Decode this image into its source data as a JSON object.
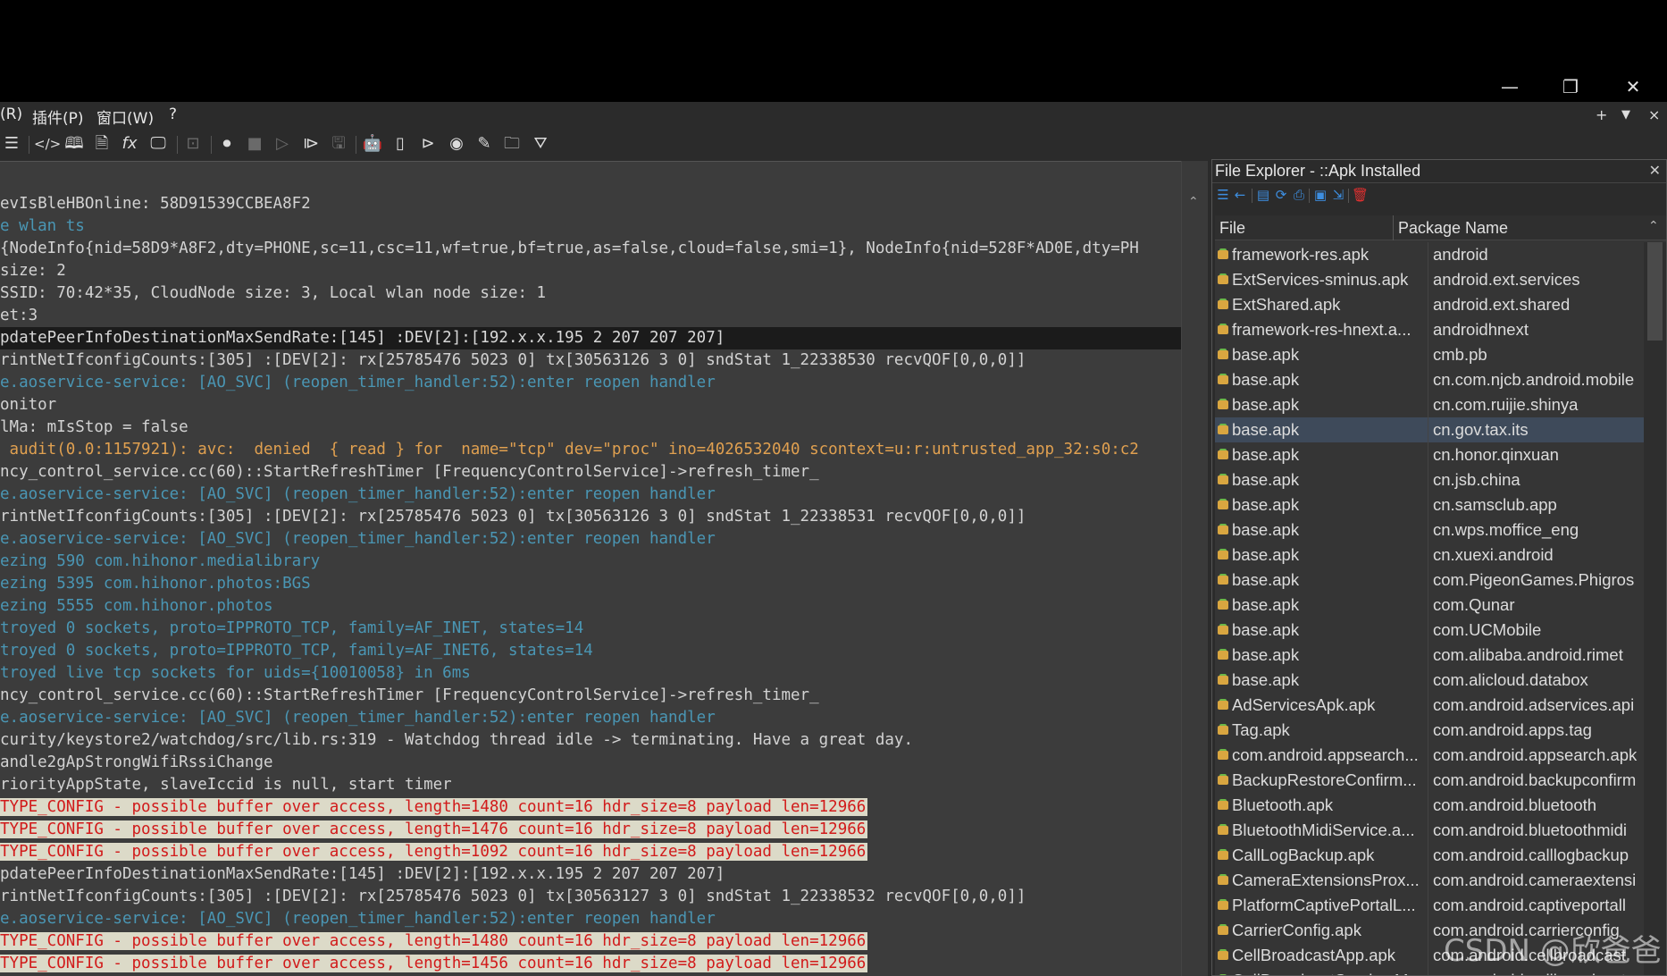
{
  "window": {
    "minimize_glyph": "—",
    "restore_glyph": "❐",
    "close_glyph": "✕"
  },
  "menu": {
    "items": [
      "(R)",
      "插件(P)",
      "窗口(W)",
      "?"
    ],
    "right_add": "+",
    "right_dropdown": "▼",
    "right_close": "×"
  },
  "toolbar": {
    "icons": [
      "list-icon",
      "code-icon",
      "book-icon",
      "document-icon",
      "function-icon",
      "screen-icon",
      "camera-focus-icon",
      "record-icon",
      "stop-icon",
      "play-icon",
      "play-box-icon",
      "save-icon",
      "android-icon",
      "phone-icon",
      "terminal-icon",
      "camera-icon",
      "edit-icon",
      "folder-icon",
      "filter-icon"
    ]
  },
  "log": {
    "lines": [
      {
        "text": "evIsBleHBOnline: 58D91539CCBEA8F2",
        "level": "default"
      },
      {
        "text": "e wlan ts",
        "level": "debug"
      },
      {
        "text": "{NodeInfo{nid=58D9*A8F2,dty=PHONE,sc=11,csc=11,wf=true,bf=true,as=false,cloud=false,smi=1}, NodeInfo{nid=528F*AD0E,dty=PH",
        "level": "default"
      },
      {
        "text": "size: 2",
        "level": "default"
      },
      {
        "text": "SSID: 70:42*35, CloudNode size: 3, Local wlan node size: 1",
        "level": "default"
      },
      {
        "text": "et:3",
        "level": "default"
      },
      {
        "text": "pdatePeerInfoDestinationMaxSendRate:[145] :DEV[2]:[192.x.x.195 2 207 207 207]",
        "level": "selected"
      },
      {
        "text": "rintNetIfconfigCounts:[305] :[DEV[2]: rx[25785476 5023 0] tx[30563126 3 0] sndStat 1_22338530 recvQOF[0,0,0]]",
        "level": "default"
      },
      {
        "text": "e.aoservice-service: [AO_SVC] (reopen_timer_handler:52):enter reopen handler",
        "level": "debug"
      },
      {
        "text": "onitor",
        "level": "default"
      },
      {
        "text": "lMa: mIsStop = false",
        "level": "default"
      },
      {
        "text": " audit(0.0:1157921): avc:  denied  { read } for  name=\"tcp\" dev=\"proc\" ino=4026532040 scontext=u:r:untrusted_app_32:s0:c2",
        "level": "warn"
      },
      {
        "text": "ncy_control_service.cc(60)::StartRefreshTimer [FrequencyControlService]->refresh_timer_",
        "level": "default"
      },
      {
        "text": "e.aoservice-service: [AO_SVC] (reopen_timer_handler:52):enter reopen handler",
        "level": "debug"
      },
      {
        "text": "rintNetIfconfigCounts:[305] :[DEV[2]: rx[25785476 5023 0] tx[30563126 3 0] sndStat 1_22338531 recvQOF[0,0,0]]",
        "level": "default"
      },
      {
        "text": "e.aoservice-service: [AO_SVC] (reopen_timer_handler:52):enter reopen handler",
        "level": "debug"
      },
      {
        "text": "ezing 590 com.hihonor.medialibrary",
        "level": "debug"
      },
      {
        "text": "ezing 5395 com.hihonor.photos:BGS",
        "level": "debug"
      },
      {
        "text": "ezing 5555 com.hihonor.photos",
        "level": "debug"
      },
      {
        "text": "troyed 0 sockets, proto=IPPROTO_TCP, family=AF_INET, states=14",
        "level": "debug"
      },
      {
        "text": "troyed 0 sockets, proto=IPPROTO_TCP, family=AF_INET6, states=14",
        "level": "debug"
      },
      {
        "text": "troyed live tcp sockets for uids={10010058} in 6ms",
        "level": "debug"
      },
      {
        "text": "ncy_control_service.cc(60)::StartRefreshTimer [FrequencyControlService]->refresh_timer_",
        "level": "default"
      },
      {
        "text": "e.aoservice-service: [AO_SVC] (reopen_timer_handler:52):enter reopen handler",
        "level": "debug"
      },
      {
        "text": "curity/keystore2/watchdog/src/lib.rs:319 - Watchdog thread idle -> terminating. Have a great day.",
        "level": "default"
      },
      {
        "text": "andle2gApStrongWifiRssiChange",
        "level": "default"
      },
      {
        "text": "riorityAppState, slaveIccid is null, start timer",
        "level": "default"
      },
      {
        "text": "TYPE_CONFIG - possible buffer over access, length=1480 count=16 hdr_size=8 payload len=12966",
        "level": "error"
      },
      {
        "text": "TYPE_CONFIG - possible buffer over access, length=1476 count=16 hdr_size=8 payload len=12966",
        "level": "error"
      },
      {
        "text": "TYPE_CONFIG - possible buffer over access, length=1092 count=16 hdr_size=8 payload len=12966",
        "level": "error"
      },
      {
        "text": "pdatePeerInfoDestinationMaxSendRate:[145] :DEV[2]:[192.x.x.195 2 207 207 207]",
        "level": "default"
      },
      {
        "text": "rintNetIfconfigCounts:[305] :[DEV[2]: rx[25785476 5023 0] tx[30563127 3 0] sndStat 1_22338532 recvQOF[0,0,0]]",
        "level": "default"
      },
      {
        "text": "e.aoservice-service: [AO_SVC] (reopen_timer_handler:52):enter reopen handler",
        "level": "debug"
      },
      {
        "text": "TYPE_CONFIG - possible buffer over access, length=1480 count=16 hdr_size=8 payload len=12966",
        "level": "error"
      },
      {
        "text": "TYPE_CONFIG - possible buffer over access, length=1456 count=16 hdr_size=8 payload len=12966",
        "level": "error"
      }
    ]
  },
  "explorer": {
    "title": "File Explorer - ::Apk Installed",
    "close": "✕",
    "columns": {
      "file": "File",
      "package": "Package Name"
    },
    "rows": [
      {
        "file": "framework-res.apk",
        "package": "android"
      },
      {
        "file": "ExtServices-sminus.apk",
        "package": "android.ext.services"
      },
      {
        "file": "ExtShared.apk",
        "package": "android.ext.shared"
      },
      {
        "file": "framework-res-hnext.a...",
        "package": "androidhnext"
      },
      {
        "file": "base.apk",
        "package": "cmb.pb"
      },
      {
        "file": "base.apk",
        "package": "cn.com.njcb.android.mobile"
      },
      {
        "file": "base.apk",
        "package": "cn.com.ruijie.shinya"
      },
      {
        "file": "base.apk",
        "package": "cn.gov.tax.its",
        "selected": true
      },
      {
        "file": "base.apk",
        "package": "cn.honor.qinxuan"
      },
      {
        "file": "base.apk",
        "package": "cn.jsb.china"
      },
      {
        "file": "base.apk",
        "package": "cn.samsclub.app"
      },
      {
        "file": "base.apk",
        "package": "cn.wps.moffice_eng"
      },
      {
        "file": "base.apk",
        "package": "cn.xuexi.android"
      },
      {
        "file": "base.apk",
        "package": "com.PigeonGames.Phigros"
      },
      {
        "file": "base.apk",
        "package": "com.Qunar"
      },
      {
        "file": "base.apk",
        "package": "com.UCMobile"
      },
      {
        "file": "base.apk",
        "package": "com.alibaba.android.rimet"
      },
      {
        "file": "base.apk",
        "package": "com.alicloud.databox"
      },
      {
        "file": "AdServicesApk.apk",
        "package": "com.android.adservices.api"
      },
      {
        "file": "Tag.apk",
        "package": "com.android.apps.tag"
      },
      {
        "file": "com.android.appsearch...",
        "package": "com.android.appsearch.apk"
      },
      {
        "file": "BackupRestoreConfirm...",
        "package": "com.android.backupconfirm"
      },
      {
        "file": "Bluetooth.apk",
        "package": "com.android.bluetooth"
      },
      {
        "file": "BluetoothMidiService.a...",
        "package": "com.android.bluetoothmidi"
      },
      {
        "file": "CallLogBackup.apk",
        "package": "com.android.calllogbackup"
      },
      {
        "file": "CameraExtensionsProx...",
        "package": "com.android.cameraextensi"
      },
      {
        "file": "PlatformCaptivePortalL...",
        "package": "com.android.captiveportall"
      },
      {
        "file": "CarrierConfig.apk",
        "package": "com.android.carrierconfig"
      },
      {
        "file": "CellBroadcastApp.apk",
        "package": "com.android.cellbroadcast"
      },
      {
        "file": "CellBroadcastService.M...",
        "package": "com.android.cellbroadcasts"
      }
    ]
  },
  "watermark": "CSDN @欣爸爸"
}
